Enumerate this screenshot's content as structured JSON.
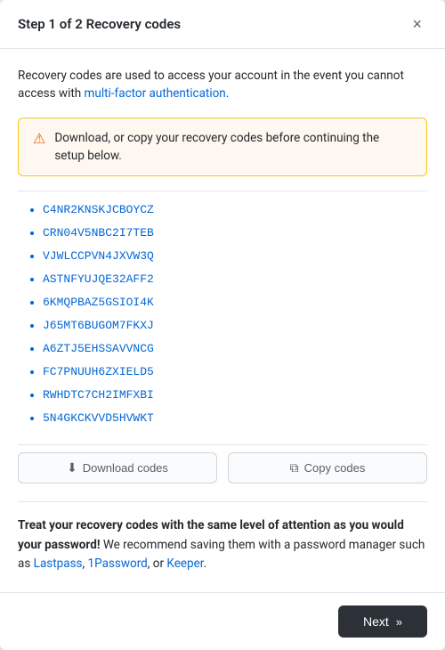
{
  "modal": {
    "header": {
      "title": "Step 1 of 2 Recovery codes",
      "close_label": "×"
    },
    "description": "Recovery codes are used to access your account in the event you cannot access with multi-factor authentication.",
    "description_link": "multi-factor authentication",
    "alert": {
      "icon": "⚠",
      "text": "Download, or copy your recovery codes before continuing the setup below."
    },
    "codes": [
      "C4NR2KNSKJCBOYCZ",
      "CRN04V5NBC2I7TEB",
      "VJWLCCPVN4JXVW3Q",
      "ASTNFYUJQE32AFF2",
      "6KMQPBAZ5GSIOI4K",
      "J65MT6BUGOM7FKXJ",
      "A6ZTJ5EHSSAVVNCG",
      "FC7PNUUH6ZXIELD5",
      "RWHDTC7CH2IMFXBI",
      "5N4GKCKVVD5HVWKT"
    ],
    "buttons": {
      "download": "Download codes",
      "copy": "Copy codes",
      "download_icon": "⬇",
      "copy_icon": "⧉"
    },
    "warning": {
      "bold_part": "Treat your recovery codes with the same level of attention as you would your password!",
      "normal_part": " We recommend saving them with a password manager such as ",
      "links": [
        "Lastpass",
        "1Password",
        "or Keeper"
      ],
      "suffix": "."
    },
    "footer": {
      "next_label": "Next",
      "next_icon": "»"
    }
  }
}
